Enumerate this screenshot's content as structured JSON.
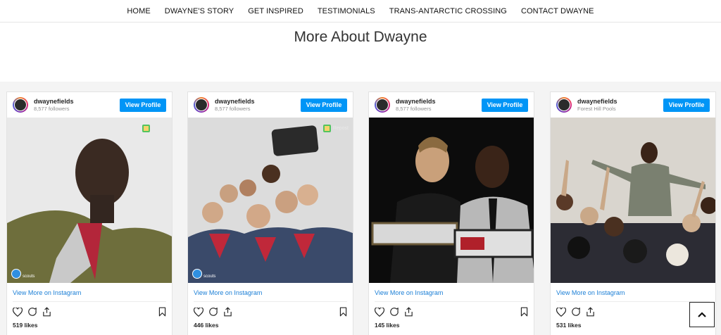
{
  "nav": {
    "items": [
      "HOME",
      "DWAYNE'S STORY",
      "GET INSPIRED",
      "TESTIMONIALS",
      "TRANS-ANTARCTIC CROSSING",
      "CONTACT DWAYNE"
    ]
  },
  "section": {
    "title": "More About Dwayne"
  },
  "posts": [
    {
      "username": "dwaynefields",
      "subtitle": "8,577 followers",
      "button": "View Profile",
      "badge": "Repost",
      "watermark": "scouts",
      "link": "View More on Instagram",
      "likes": "519 likes"
    },
    {
      "username": "dwaynefields",
      "subtitle": "8,577 followers",
      "button": "View Profile",
      "badge": "Repost",
      "watermark": "scouts",
      "link": "View More on Instagram",
      "likes": "446 likes"
    },
    {
      "username": "dwaynefields",
      "subtitle": "8,577 followers",
      "button": "View Profile",
      "link": "View More on Instagram",
      "likes": "145 likes"
    },
    {
      "username": "dwaynefields",
      "subtitle": "Forest Hill Pools",
      "button": "View Profile",
      "link": "View More on Instagram",
      "likes": "531 likes"
    }
  ],
  "icons": {
    "like": "heart-icon",
    "comment": "comment-icon",
    "share": "share-icon",
    "save": "bookmark-icon",
    "scroll_top": "chevron-up-icon"
  },
  "colors": {
    "button": "#0095f6",
    "link": "#1b7fd6",
    "feed_bg": "#f4f4f4"
  }
}
